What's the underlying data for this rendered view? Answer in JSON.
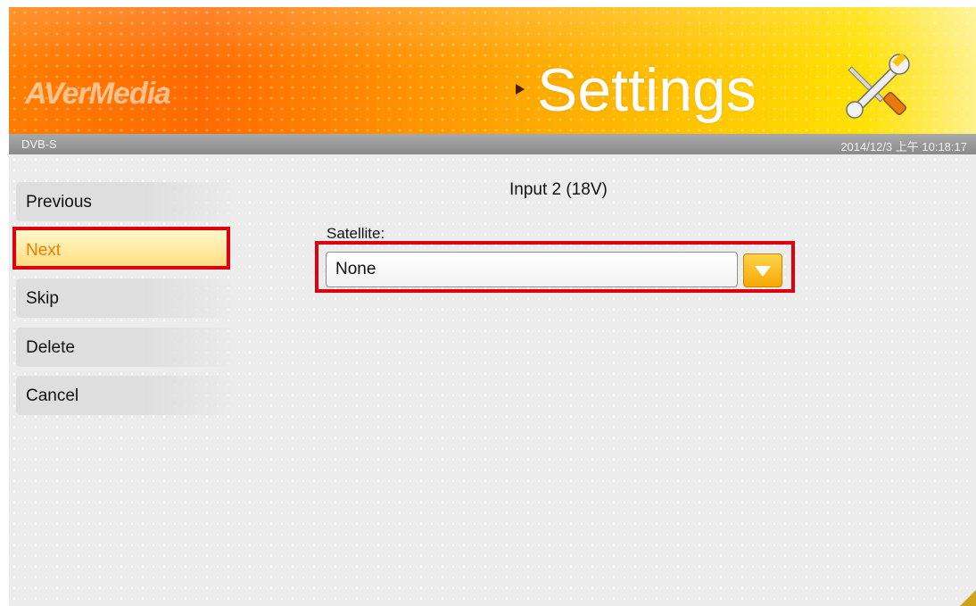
{
  "header": {
    "logo_text": "AVerMedia",
    "title": "Settings",
    "icon": "tools-icon"
  },
  "statusbar": {
    "mode": "DVB-S",
    "datetime": "2014/12/3 上午 10:18:17"
  },
  "menu": {
    "items": [
      {
        "label": "Previous"
      },
      {
        "label": "Next",
        "selected": true,
        "highlighted": true
      },
      {
        "label": "Skip"
      },
      {
        "label": "Delete"
      },
      {
        "label": "Cancel"
      }
    ]
  },
  "main": {
    "input_title": "Input 2 (18V)",
    "satellite_label": "Satellite:",
    "satellite_value": "None",
    "dropdown_icon": "chevron-down-icon"
  },
  "colors": {
    "highlight_box": "#e00010",
    "active_text": "#f07d00",
    "header_orange": "#ff7d00",
    "header_yellow": "#ffe000"
  }
}
